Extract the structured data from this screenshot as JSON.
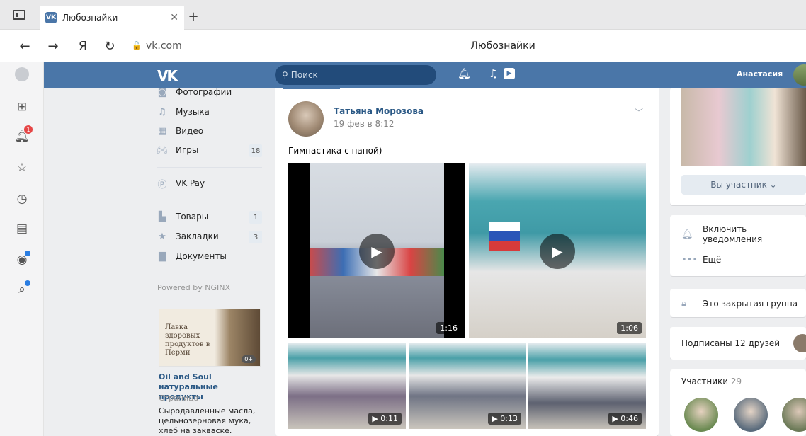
{
  "browser": {
    "tab_title": "Любознайки",
    "tab_favicon": "VK",
    "url": "vk.com",
    "page_title": "Любознайки",
    "yandex_label": "Я"
  },
  "header": {
    "logo": "VK",
    "search_placeholder": "Поиск",
    "user_name": "Анастасия"
  },
  "left_nav": {
    "items": [
      {
        "label": "Фотографии",
        "icon": "photo-icon"
      },
      {
        "label": "Музыка",
        "icon": "music-icon"
      },
      {
        "label": "Видео",
        "icon": "video-icon"
      },
      {
        "label": "Игры",
        "icon": "games-icon",
        "count": "18"
      },
      {
        "label": "VK Pay",
        "icon": "vkpay-icon"
      },
      {
        "label": "Товары",
        "icon": "goods-icon",
        "count": "1"
      },
      {
        "label": "Закладки",
        "icon": "bookmark-icon",
        "count": "3"
      },
      {
        "label": "Документы",
        "icon": "document-icon"
      }
    ],
    "powered": "Powered by NGINX"
  },
  "ad": {
    "image_text": "Лавка здоровых продуктов в Перми",
    "age_badge": "0+",
    "title": "Oil and Soul натуральные продукты",
    "subtitle": "Страница",
    "description": "Сыродавленные масла, цельнозерновая мука, хлеб на закваске."
  },
  "post": {
    "author": "Татьяна Морозова",
    "date": "19 фев в 8:12",
    "text": "Гимнастика с папой)",
    "videos": [
      {
        "duration": "1:16"
      },
      {
        "duration": "1:06"
      },
      {
        "duration": "▶ 0:11"
      },
      {
        "duration": "▶ 0:13"
      },
      {
        "duration": "▶ 0:46"
      }
    ]
  },
  "right": {
    "member_button": "Вы участник ⌄",
    "notify": "Включить уведомления",
    "more": "Ещё",
    "closed_group": "Это закрытая группа",
    "friends": "Подписаны 12 друзей",
    "members_label": "Участники",
    "members_count": "29"
  },
  "colors": {
    "vk_blue": "#4a76a8",
    "link": "#2a5885",
    "bg": "#edeef0"
  }
}
